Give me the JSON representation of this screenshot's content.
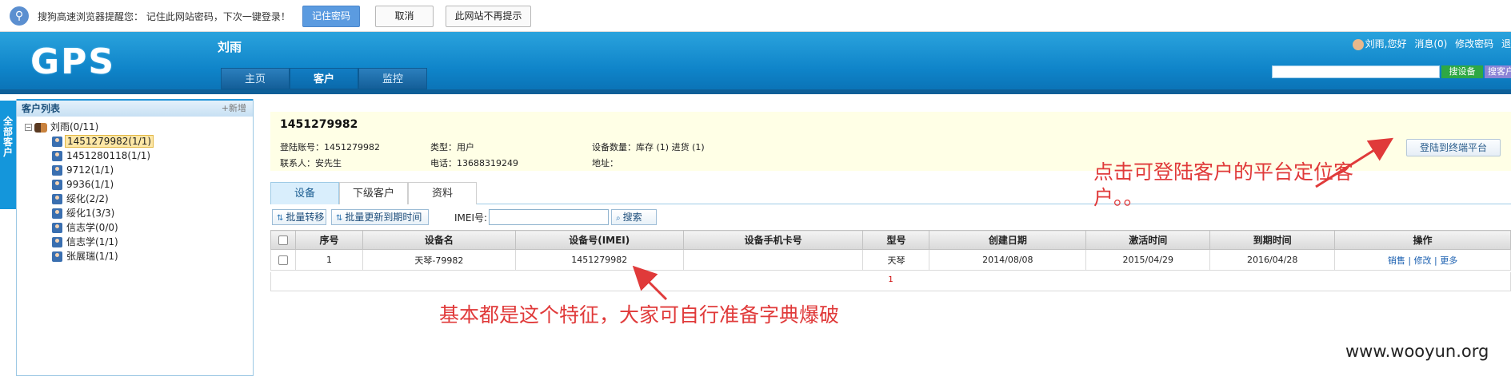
{
  "password_bar": {
    "message": "搜狗高速浏览器提醒您： 记住此网站密码，下次一键登录！",
    "remember_label": "记住密码",
    "cancel_label": "取消",
    "never_label": "此网站不再提示"
  },
  "header": {
    "logo": "GPS",
    "username": "刘雨",
    "nav_tabs": [
      "主页",
      "客户",
      "监控"
    ],
    "active_tab": "客户",
    "greeting": "刘雨,您好",
    "messages": "消息(0)",
    "change_password": "修改密码",
    "more_link": "退",
    "search_device_label": "搜设备",
    "search_customer_label": "搜客户"
  },
  "sidebar": {
    "strip_label": "全部客户",
    "title": "客户列表",
    "add_new": "+新增",
    "root": "刘雨(0/11)",
    "root_toggle": "⊟",
    "items": [
      "1451279982(1/1)",
      "1451280118(1/1)",
      "9712(1/1)",
      "9936(1/1)",
      "绥化(2/2)",
      "绥化1(3/3)",
      "信志学(0/0)",
      "信志学(1/1)",
      "张展瑞(1/1)"
    ],
    "selected_index": 0
  },
  "info": {
    "title": "1451279982",
    "login_account": "登陆账号：1451279982",
    "type": "类型：用户",
    "device_count": "设备数量：库存 (1) 进货 (1)",
    "contact": "联系人：安先生",
    "phone": "电话：13688319249",
    "address": "地址：",
    "login_button": "登陆到终端平台"
  },
  "tabs": [
    "设备",
    "下级客户",
    "资料"
  ],
  "active_content_tab": "设备",
  "toolbar": {
    "batch_transfer": "批量转移",
    "batch_update": "批量更新到期时间",
    "imei_label": "IMEI号:",
    "imei_value": "",
    "search": "搜索"
  },
  "table": {
    "headers": [
      "序号",
      "设备名",
      "设备号(IMEI)",
      "设备手机卡号",
      "型号",
      "创建日期",
      "激活时间",
      "到期时间",
      "操作"
    ],
    "rows": [
      {
        "index": "1",
        "name": "天琴-79982",
        "imei": "1451279982",
        "sim": "",
        "model": "天琴",
        "created": "2014/08/08",
        "activated": "2015/04/29",
        "expires": "2016/04/28",
        "ops": [
          "销售",
          "修改",
          "更多"
        ]
      }
    ],
    "page": "1"
  },
  "annotations": {
    "login_note": "点击可登陆客户的平台定位客户。。",
    "imei_note": "基本都是这个特征，大家可自行准备字典爆破",
    "color": "#e03a3a"
  },
  "watermark": "www.wooyun.org"
}
